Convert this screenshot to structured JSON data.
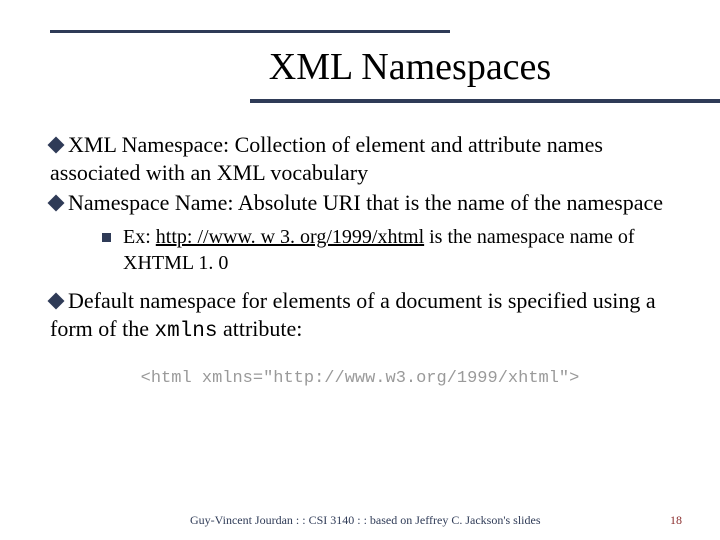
{
  "title": "XML Namespaces",
  "bullets": {
    "b1": "XML Namespace: Collection of element and attribute names associated with an XML vocabulary",
    "b2": "Namespace Name: Absolute URI that is the name of the namespace",
    "sub1_prefix": "Ex: ",
    "sub1_link": "http: //www. w 3. org/1999/xhtml",
    "sub1_suffix": " is the namespace name of XHTML 1. 0",
    "b3_prefix": "Default namespace for elements of a document is specified using a form of the ",
    "b3_code": "xmlns",
    "b3_suffix": " attribute:"
  },
  "code": "<html xmlns=\"http://www.w3.org/1999/xhtml\">",
  "footer": {
    "text": "Guy-Vincent Jourdan : : CSI 3140 : : based on Jeffrey C. Jackson's slides",
    "page": "18"
  }
}
